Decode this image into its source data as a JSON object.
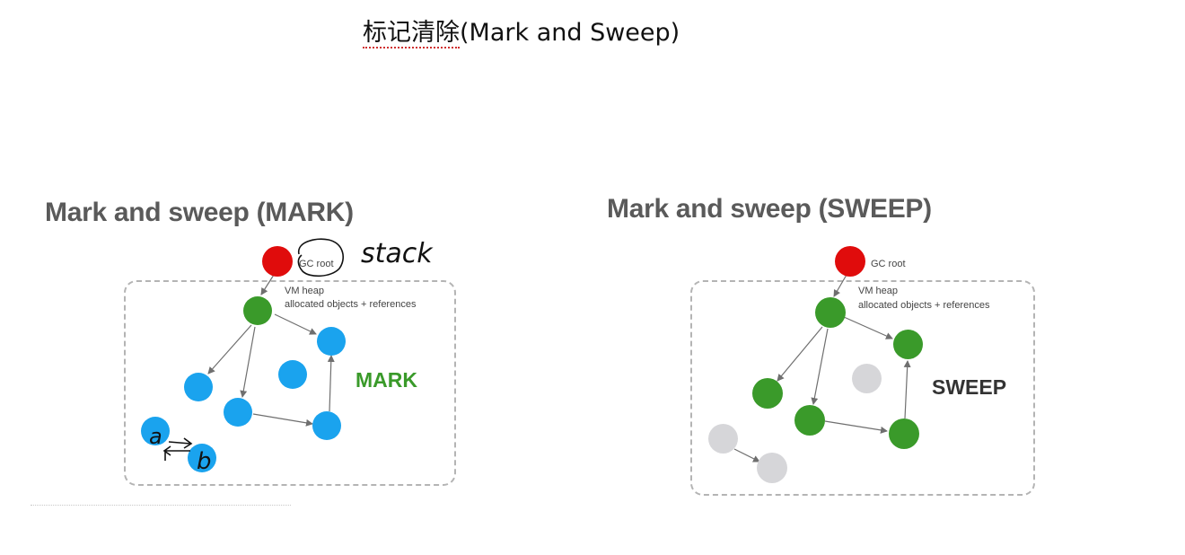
{
  "title": {
    "chinese": "标记清除",
    "english": "(Mark and Sweep)"
  },
  "panels": {
    "mark": {
      "title": "Mark and sweep (MARK)",
      "gc_root_label": "GC root",
      "heap_label_line1": "VM heap",
      "heap_label_line2": "allocated objects + references",
      "phase_label": "MARK",
      "phase_color": "#3a9a2a",
      "handwriting": {
        "stack": "stack",
        "a": "a",
        "b": "b"
      }
    },
    "sweep": {
      "title": "Mark and sweep (SWEEP)",
      "gc_root_label": "GC root",
      "heap_label_line1": "VM heap",
      "heap_label_line2": "allocated objects + references",
      "phase_label": "SWEEP",
      "phase_color": "#333333"
    }
  },
  "colors": {
    "root": "#e00c0c",
    "reachable": "#3a9a2a",
    "unmarked": "#1aa3ee",
    "swept": "#d6d6d9",
    "edge": "#6f6f6f",
    "ink": "#111111"
  }
}
